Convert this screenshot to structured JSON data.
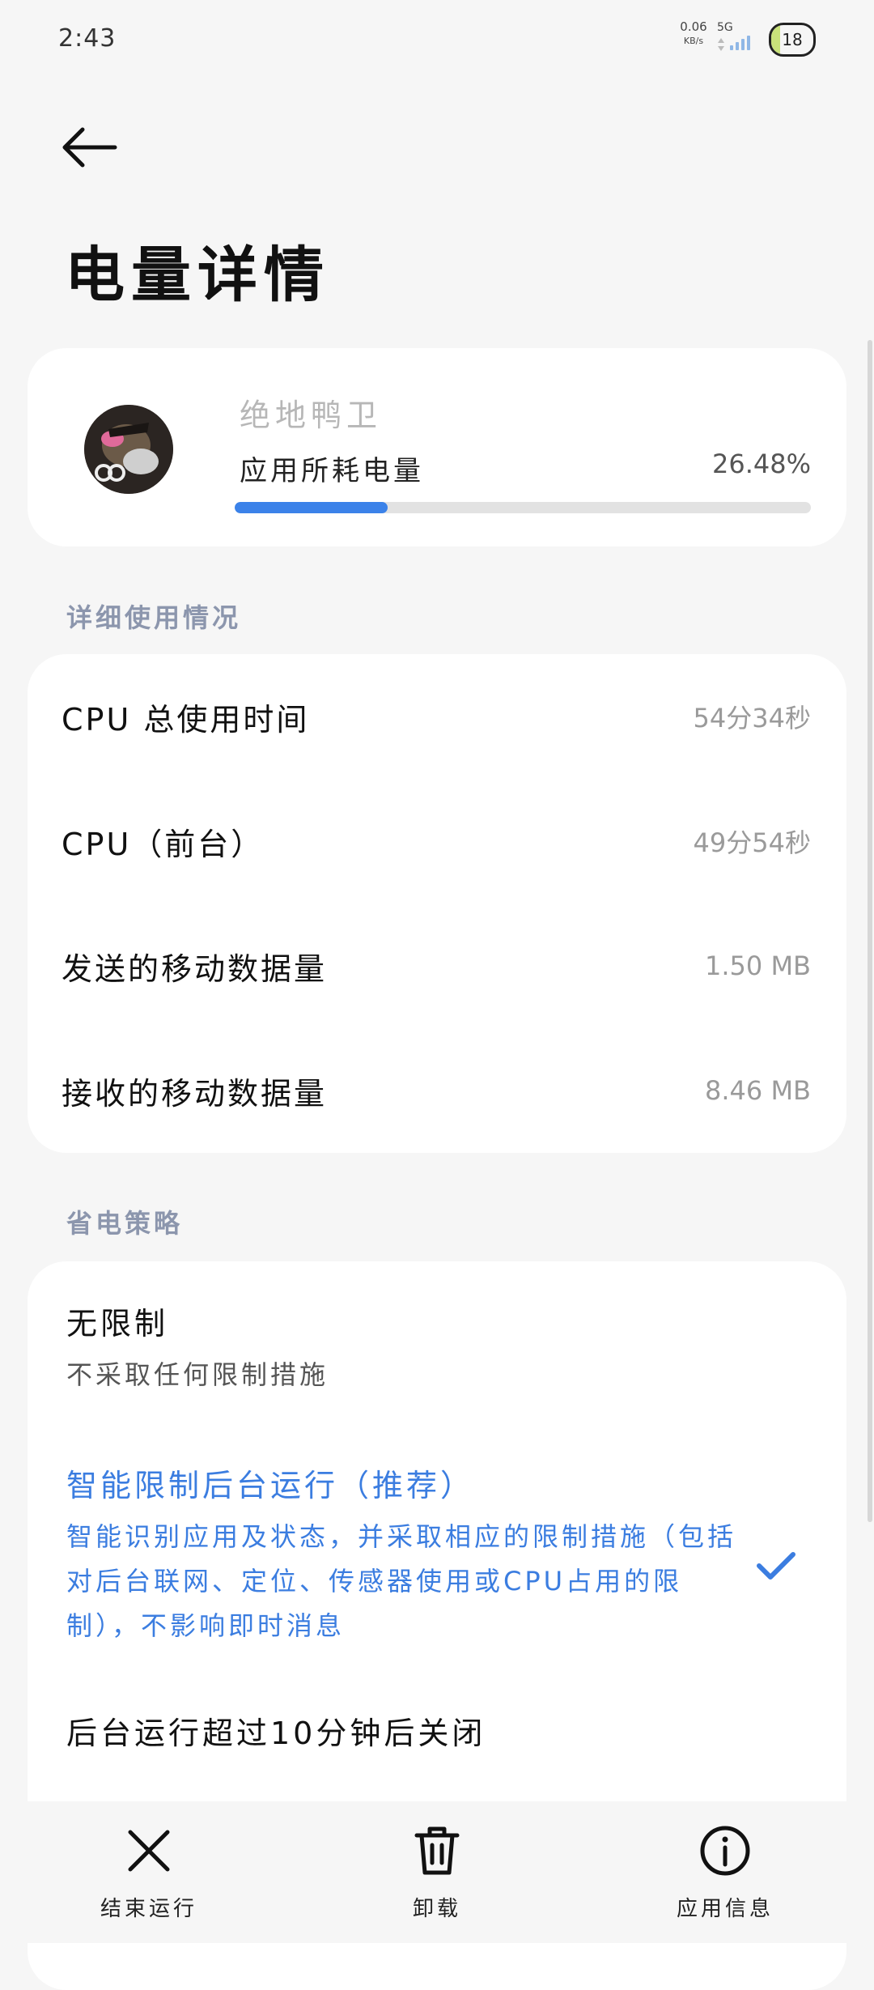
{
  "status_bar": {
    "time": "2:43",
    "net_speed_value": "0.06",
    "net_speed_unit": "KB/s",
    "network_type": "5G",
    "battery_level": "18"
  },
  "header": {
    "title": "电量详情"
  },
  "app_card": {
    "app_name": "绝地鸭卫",
    "usage_label": "应用所耗电量",
    "usage_value": "26.48%",
    "usage_fraction": 0.2648
  },
  "detail_section": {
    "header": "详细使用情况",
    "rows": [
      {
        "label": "CPU 总使用时间",
        "value": "54分34秒"
      },
      {
        "label": "CPU（前台）",
        "value": "49分54秒"
      },
      {
        "label": "发送的移动数据量",
        "value": "1.50 MB"
      },
      {
        "label": "接收的移动数据量",
        "value": "8.46 MB"
      }
    ]
  },
  "strategy_section": {
    "header": "省电策略",
    "options": [
      {
        "title": "无限制",
        "desc": "不采取任何限制措施",
        "selected": false
      },
      {
        "title": "智能限制后台运行（推荐）",
        "desc": "智能识别应用及状态，并采取相应的限制措施（包括对后台联网、定位、传感器使用或CPU占用的限制），不影响即时消息",
        "selected": true
      },
      {
        "title": "后台运行超过10分钟后关闭",
        "desc": "",
        "selected": false
      }
    ]
  },
  "bottom_bar": {
    "end_label": "结束运行",
    "uninstall_label": "卸载",
    "info_label": "应用信息"
  },
  "colors": {
    "accent": "#3b7de0",
    "progress": "#3b82e9",
    "section_header": "#8c96ad"
  }
}
